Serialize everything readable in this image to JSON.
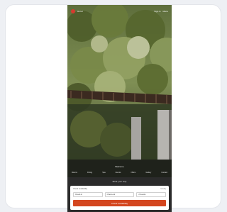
{
  "header": {
    "brand": "Hotel",
    "links": [
      "Sign in",
      "Menu"
    ]
  },
  "hero": {
    "caption": "Welcome"
  },
  "nav": {
    "items": [
      "Rooms",
      "Dining",
      "Spa",
      "Events",
      "Offers",
      "Gallery",
      "Contact"
    ]
  },
  "booking": {
    "tagline": "Book your stay",
    "form_title": "Check availability",
    "form_link": "Modify",
    "check_in_value": "Check-in",
    "check_out_value": "Check-out",
    "guests_value": "2 Guests",
    "cta_label": "Check availability"
  },
  "colors": {
    "accent": "#d4461f",
    "logo": "#d63a2e",
    "panel": "#2b2b2b",
    "page_bg": "#eef0f4"
  }
}
